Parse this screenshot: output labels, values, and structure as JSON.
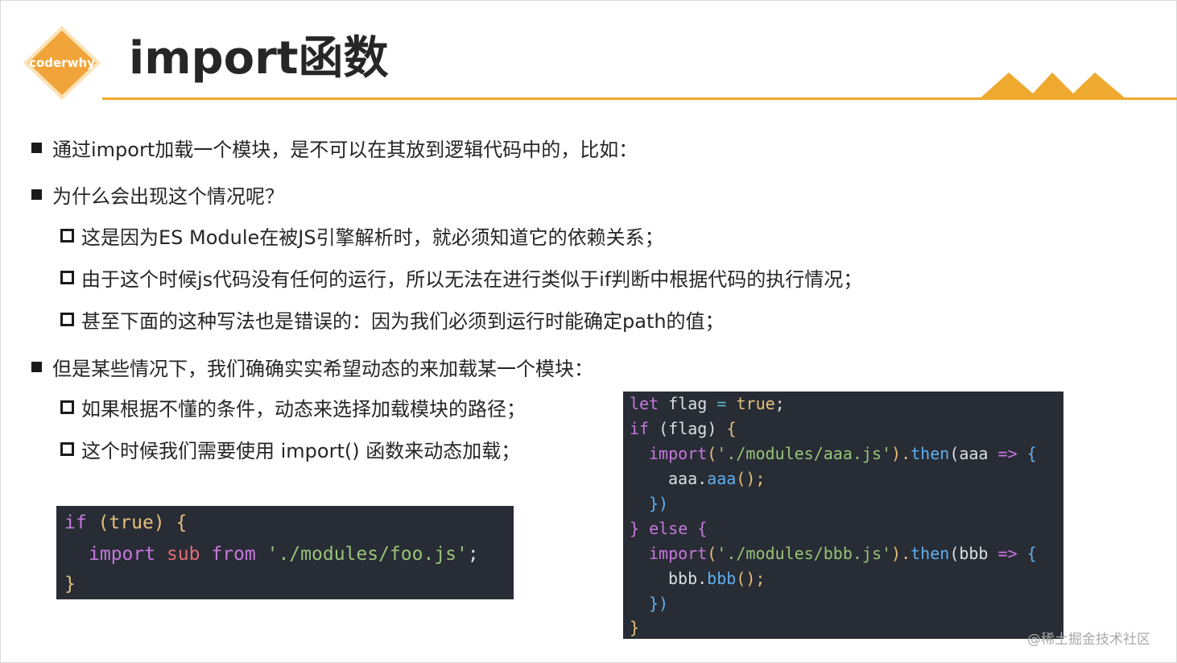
{
  "logo": {
    "text": "coderwhy"
  },
  "title": "import函数",
  "bullets": {
    "b1": "通过import加载一个模块，是不可以在其放到逻辑代码中的，比如：",
    "b2": "为什么会出现这个情况呢？",
    "b2_sub1": "这是因为ES Module在被JS引擎解析时，就必须知道它的依赖关系；",
    "b2_sub2": "由于这个时候js代码没有任何的运行，所以无法在进行类似于if判断中根据代码的执行情况；",
    "b2_sub3": "甚至下面的这种写法也是错误的：因为我们必须到运行时能确定path的值；",
    "b3": "但是某些情况下，我们确确实实希望动态的来加载某一个模块：",
    "b3_sub1": "如果根据不懂的条件，动态来选择加载模块的路径；",
    "b3_sub2": "这个时候我们需要使用 import() 函数来动态加载；"
  },
  "code1": {
    "l1_if": "if",
    "l1_cond": "(true)",
    "l1_brace": "{",
    "l2_import": "import",
    "l2_name": "sub",
    "l2_from": "from",
    "l2_path": "'./modules/foo.js'",
    "l2_semi": ";",
    "l3_brace": "}"
  },
  "code2": {
    "l1_let": "let",
    "l1_var": "flag",
    "l1_eq": "=",
    "l1_val": "true",
    "l1_semi": ";",
    "l2_if": "if",
    "l2_cond": "(flag)",
    "l2_brace": "{",
    "l3_import": "import",
    "l3_paren": "(",
    "l3_path": "'./modules/aaa.js'",
    "l3_paren2": ").",
    "l3_then": "then",
    "l3_arg": "(aaa",
    "l3_arrow": "=>",
    "l3_brace": "{",
    "l4_obj": "aaa.",
    "l4_fn": "aaa",
    "l4_call": "();",
    "l5_close": "})",
    "l6_else": "} else {",
    "l7_import": "import",
    "l7_paren": "(",
    "l7_path": "'./modules/bbb.js'",
    "l7_paren2": ").",
    "l7_then": "then",
    "l7_arg": "(bbb",
    "l7_arrow": "=>",
    "l7_brace": "{",
    "l8_obj": "bbb.",
    "l8_fn": "bbb",
    "l8_call": "();",
    "l9_close": "})",
    "l10_close": "}"
  },
  "watermark": "@稀土掘金技术社区",
  "colors": {
    "accent": "#efa92f",
    "code_bg": "#282c34"
  }
}
